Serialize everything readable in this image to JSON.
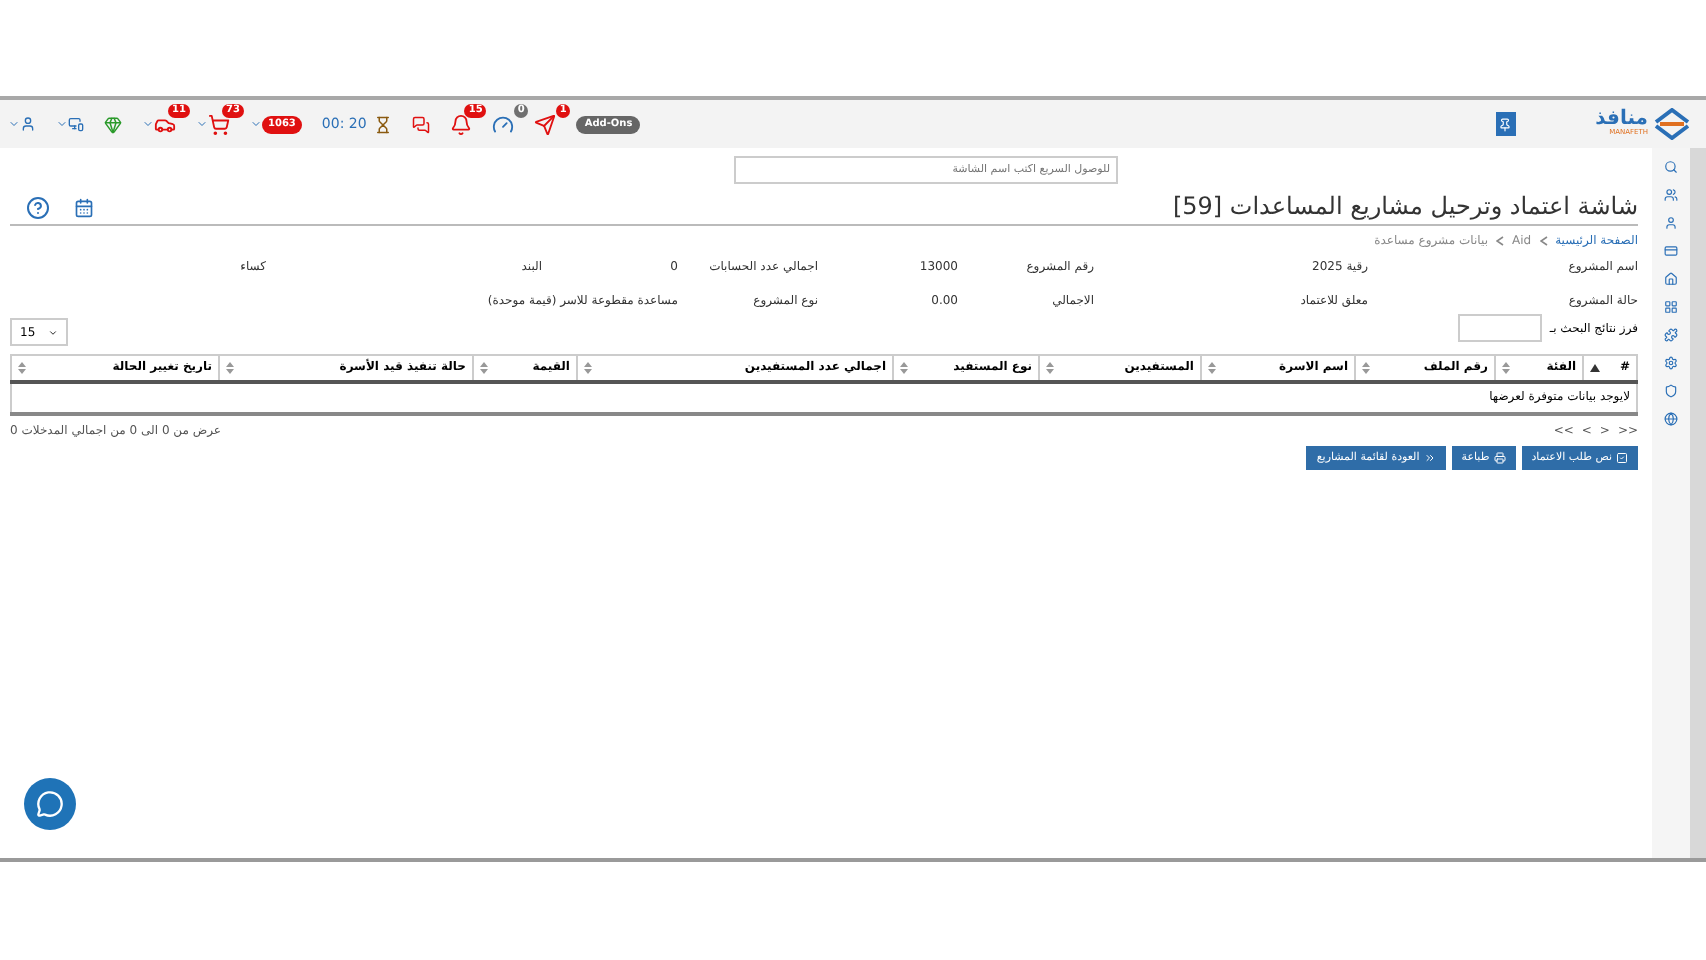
{
  "top_bar": {
    "items": [
      {
        "kind": "addon",
        "text": "Add-Ons"
      },
      {
        "kind": "badge",
        "badge": "1",
        "color": "#e01010"
      },
      {
        "kind": "badge",
        "badge": "0",
        "color": "#707070"
      },
      {
        "kind": "badge",
        "badge": "15",
        "color": "#e01010"
      },
      {
        "kind": "plain"
      },
      {
        "kind": "timer",
        "text": "00: 20"
      },
      {
        "kind": "pill",
        "badge": "1063",
        "color": "#e01010"
      },
      {
        "kind": "badge",
        "badge": "73",
        "color": "#e01010"
      },
      {
        "kind": "badge",
        "badge": "11",
        "color": "#e01010"
      },
      {
        "kind": "plain"
      },
      {
        "kind": "menu"
      },
      {
        "kind": "menu"
      }
    ],
    "logo": {
      "name": "منافذ",
      "sub": "MANAFETH"
    }
  },
  "search": {
    "placeholder": "للوصول السريع اكتب اسم الشاشة"
  },
  "title": "شاشة اعتماد وترحيل مشاريع المساعدات [59]",
  "breadcrumb": [
    "الصفحة الرئيسية",
    "Aid",
    "بيانات مشروع مساعدة"
  ],
  "fields": [
    [
      {
        "label": "اسم المشروع",
        "value": "رقية 2025"
      },
      {
        "label": "رقم المشروع",
        "value": "13000"
      },
      {
        "label": "اجمالي عدد الحسابات",
        "value": "0"
      },
      {
        "label": "البند",
        "value": "كساء"
      }
    ],
    [
      {
        "label": "حالة المشروع",
        "value": "معلق للاعتماد"
      },
      {
        "label": "الاجمالي",
        "value": "0.00"
      },
      {
        "label": "نوع المشروع",
        "value": "مساعدة مقطوعة للاسر (قيمة موحدة)"
      }
    ]
  ],
  "sort_label": "فرز نتائج البحث بـ",
  "page_size": "15",
  "table": {
    "columns": [
      {
        "label": "#",
        "sorted": true
      },
      {
        "label": "الفئة",
        "sorted": false
      },
      {
        "label": "رقم الملف",
        "sorted": false
      },
      {
        "label": "اسم الاسرة",
        "sorted": false
      },
      {
        "label": "المستفيدين",
        "sorted": false
      },
      {
        "label": "نوع المستفيد",
        "sorted": false
      },
      {
        "label": "اجمالي عدد المستفيدين",
        "sorted": false
      },
      {
        "label": "القيمة",
        "sorted": false
      },
      {
        "label": "حالة تنفيذ قيد الأسرة",
        "sorted": false
      },
      {
        "label": "تاريخ تغيير الحالة",
        "sorted": false
      }
    ],
    "empty": "لايوجد بيانات متوفرة لعرضها"
  },
  "pagination": [
    ">>",
    ">",
    "<",
    "<<"
  ],
  "info": "عرض من 0 الى 0 من اجمالي المدخلات 0",
  "buttons": [
    {
      "label": "نص طلب الاعتماد",
      "kind": "approve"
    },
    {
      "label": "طباعة",
      "kind": "print"
    },
    {
      "label": "العودة لقائمة المشاريع",
      "kind": "back"
    }
  ]
}
